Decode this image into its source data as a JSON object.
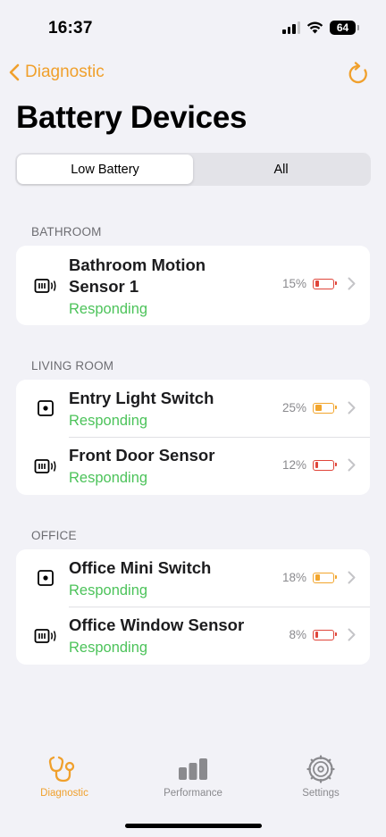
{
  "status_bar": {
    "time": "16:37",
    "battery_level": "64"
  },
  "nav": {
    "back_label": "Diagnostic",
    "title": "Battery Devices"
  },
  "segments": [
    {
      "label": "Low Battery",
      "active": true
    },
    {
      "label": "All",
      "active": false
    }
  ],
  "sections": [
    {
      "header": "BATHROOM",
      "rows": [
        {
          "name_line1": "Bathroom Motion",
          "name_line2": "Sensor 1",
          "status": "Responding",
          "percent": "15%",
          "level": 0.15,
          "level_color": "#e0453a",
          "icon": "sensor-icon"
        }
      ]
    },
    {
      "header": "LIVING ROOM",
      "rows": [
        {
          "name": "Entry Light Switch",
          "status": "Responding",
          "percent": "25%",
          "level": 0.25,
          "level_color": "#f2a52c",
          "icon": "switch-icon"
        },
        {
          "name": "Front Door Sensor",
          "status": "Responding",
          "percent": "12%",
          "level": 0.12,
          "level_color": "#e0453a",
          "icon": "sensor-icon"
        }
      ]
    },
    {
      "header": "OFFICE",
      "rows": [
        {
          "name": "Office Mini Switch",
          "status": "Responding",
          "percent": "18%",
          "level": 0.18,
          "level_color": "#f2a52c",
          "icon": "switch-icon"
        },
        {
          "name": "Office Window Sensor",
          "status": "Responding",
          "percent": "8%",
          "level": 0.08,
          "level_color": "#e0453a",
          "icon": "sensor-icon"
        }
      ]
    }
  ],
  "tabbar": [
    {
      "label": "Diagnostic",
      "icon": "stethoscope-icon",
      "active": true
    },
    {
      "label": "Performance",
      "icon": "bar-chart-icon",
      "active": false
    },
    {
      "label": "Settings",
      "icon": "gear-icon",
      "active": false
    }
  ],
  "colors": {
    "accent": "#f0a02c",
    "responding": "#4cc35a",
    "battery_low": "#e0453a",
    "battery_mid": "#f2a52c"
  }
}
